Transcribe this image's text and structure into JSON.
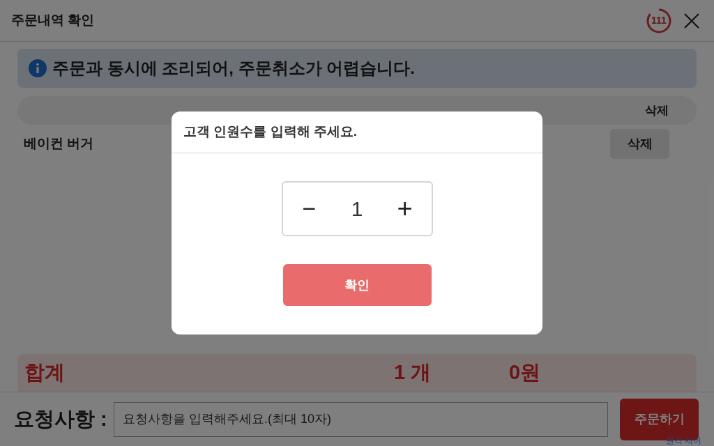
{
  "header": {
    "title": "주문내역 확인",
    "timer": "111"
  },
  "notice": "주문과 동시에 조리되어, 주문취소가 어렵습니다.",
  "table": {
    "columns": [
      "삭제"
    ],
    "rows": [
      {
        "menu": "베이컨 버거",
        "action": "삭제"
      }
    ]
  },
  "total": {
    "label": "합계",
    "quantity": "1 개",
    "amount": "0원"
  },
  "request": {
    "label": "요청사항 :",
    "placeholder": "요청사항을 입력해주세요.(최대 10자)",
    "submit": "주문하기"
  },
  "remote_notice": "원격 제어",
  "modal": {
    "title": "고객 인원수를 입력해 주세요.",
    "minus": "−",
    "value": "1",
    "plus": "+",
    "confirm": "확인"
  }
}
